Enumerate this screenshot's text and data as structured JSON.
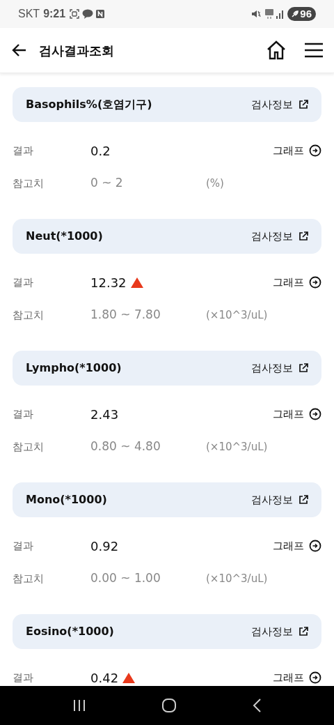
{
  "status_bar": {
    "carrier": "SKT",
    "time": "9:21",
    "battery": "96"
  },
  "header": {
    "title": "검사결과조회"
  },
  "tests": [
    {
      "name": "Basophils%(호염기구)",
      "info_link": "검사정보",
      "result_label": "결과",
      "result": "0.2",
      "high": false,
      "graph_link": "그래프",
      "reference_label": "참고치",
      "reference": "0 ~ 2",
      "unit": "(%)"
    },
    {
      "name": "Neut(*1000)",
      "info_link": "검사정보",
      "result_label": "결과",
      "result": "12.32",
      "high": true,
      "graph_link": "그래프",
      "reference_label": "참고치",
      "reference": "1.80 ~ 7.80",
      "unit": "(×10^3/uL)"
    },
    {
      "name": "Lympho(*1000)",
      "info_link": "검사정보",
      "result_label": "결과",
      "result": "2.43",
      "high": false,
      "graph_link": "그래프",
      "reference_label": "참고치",
      "reference": "0.80 ~ 4.80",
      "unit": "(×10^3/uL)"
    },
    {
      "name": "Mono(*1000)",
      "info_link": "검사정보",
      "result_label": "결과",
      "result": "0.92",
      "high": false,
      "graph_link": "그래프",
      "reference_label": "참고치",
      "reference": "0.00 ~ 1.00",
      "unit": "(×10^3/uL)"
    },
    {
      "name": "Eosino(*1000)",
      "info_link": "검사정보",
      "result_label": "결과",
      "result": "0.42",
      "high": true,
      "graph_link": "그래프"
    }
  ]
}
